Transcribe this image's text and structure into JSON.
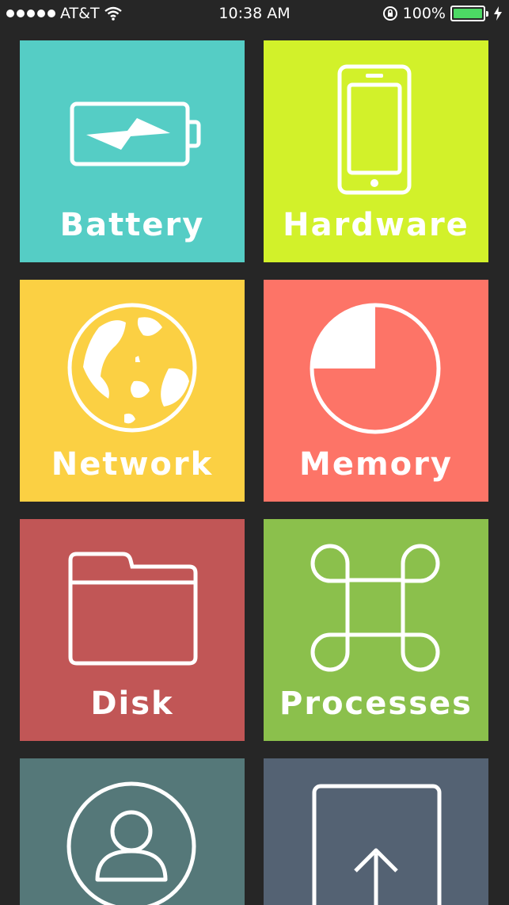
{
  "status_bar": {
    "carrier": "AT&T",
    "time": "10:38 AM",
    "battery_percent": "100%",
    "battery_level": 1.0
  },
  "tiles": [
    {
      "label": "Battery",
      "color": "#55cdc5",
      "icon": "battery-icon"
    },
    {
      "label": "Hardware",
      "color": "#d2f12a",
      "icon": "phone-icon"
    },
    {
      "label": "Network",
      "color": "#fbd043",
      "icon": "globe-icon"
    },
    {
      "label": "Memory",
      "color": "#fd7467",
      "icon": "pie-chart-icon"
    },
    {
      "label": "Disk",
      "color": "#c15656",
      "icon": "folder-icon"
    },
    {
      "label": "Processes",
      "color": "#8bc04c",
      "icon": "command-icon"
    },
    {
      "label": "",
      "color": "#557879",
      "icon": "user-icon"
    },
    {
      "label": "",
      "color": "#546273",
      "icon": "share-icon"
    }
  ]
}
